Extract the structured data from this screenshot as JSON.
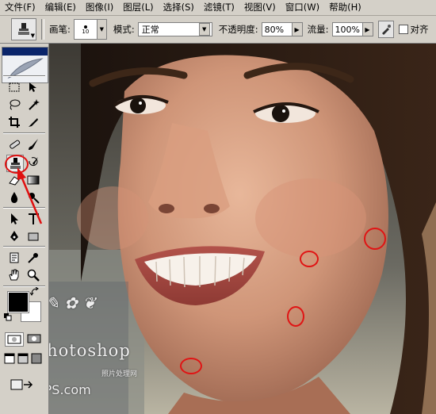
{
  "menubar": {
    "items": [
      {
        "label": "文件(F)",
        "key": "file"
      },
      {
        "label": "编辑(E)",
        "key": "edit"
      },
      {
        "label": "图像(I)",
        "key": "image"
      },
      {
        "label": "图层(L)",
        "key": "layer"
      },
      {
        "label": "选择(S)",
        "key": "select"
      },
      {
        "label": "滤镜(T)",
        "key": "filter"
      },
      {
        "label": "视图(V)",
        "key": "view"
      },
      {
        "label": "窗口(W)",
        "key": "window"
      },
      {
        "label": "帮助(H)",
        "key": "help"
      }
    ]
  },
  "options": {
    "brush_label": "画笔:",
    "brush_size": "10",
    "mode_label": "模式:",
    "mode_value": "正常",
    "opacity_label": "不透明度:",
    "opacity_value": "80%",
    "flow_label": "流量:",
    "flow_value": "100%",
    "align_label": "对齐"
  },
  "watermark": {
    "forum": "Photoshop",
    "site": "PhotoPS.com",
    "small": "照片处理网"
  },
  "colors": {
    "foreground": "#000000",
    "background": "#ffffff",
    "highlight": "#e01010"
  },
  "active_tool": "clone-stamp-icon"
}
